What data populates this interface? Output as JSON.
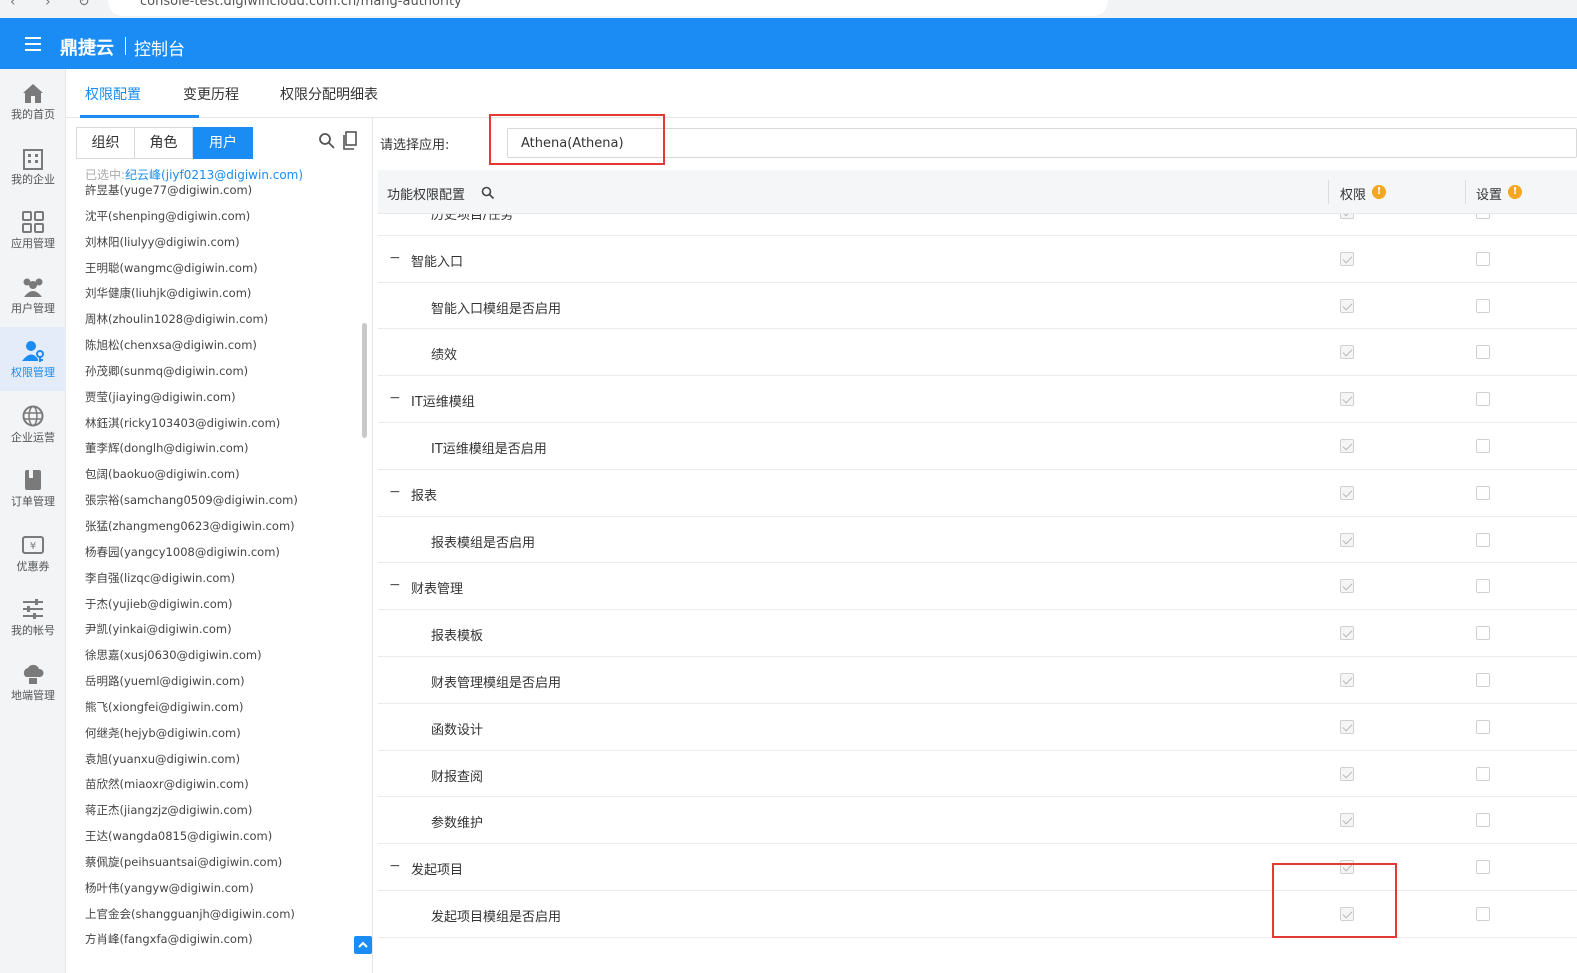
{
  "browser": {
    "url": "console-test.digiwincloud.com.cn/mang-authority"
  },
  "header": {
    "brand": "鼎捷云",
    "console": "控制台"
  },
  "leftnav": {
    "items": [
      {
        "label": "我的首页",
        "icon": "home-icon"
      },
      {
        "label": "我的企业",
        "icon": "building-icon"
      },
      {
        "label": "应用管理",
        "icon": "apps-icon"
      },
      {
        "label": "用户管理",
        "icon": "users-icon"
      },
      {
        "label": "权限管理",
        "icon": "user-key-icon",
        "active": true
      },
      {
        "label": "企业运营",
        "icon": "globe-icon"
      },
      {
        "label": "订单管理",
        "icon": "order-book-icon"
      },
      {
        "label": "优惠券",
        "icon": "coupon-icon"
      },
      {
        "label": "我的帐号",
        "icon": "sliders-icon"
      },
      {
        "label": "地端管理",
        "icon": "cloud-server-icon"
      }
    ]
  },
  "tabs": [
    {
      "label": "权限配置",
      "active": true
    },
    {
      "label": "变更历程"
    },
    {
      "label": "权限分配明细表"
    }
  ],
  "userpanel": {
    "segments": [
      {
        "label": "组织"
      },
      {
        "label": "角色"
      },
      {
        "label": "用户",
        "active": true
      }
    ],
    "selected_prefix": "已选中:",
    "selected_user": "纪云峰(jiyf0213@digiwin.com)",
    "users": [
      "許昱基(yuge77@digiwin.com)",
      "沈平(shenping@digiwin.com)",
      "刘林阳(liulyy@digiwin.com)",
      "王明聪(wangmc@digiwin.com)",
      "刘华健康(liuhjk@digiwin.com)",
      "周林(zhoulin1028@digiwin.com)",
      "陈旭松(chenxsa@digiwin.com)",
      "孙茂卿(sunmq@digiwin.com)",
      "贾莹(jiaying@digiwin.com)",
      "林鈺淇(ricky103403@digiwin.com)",
      "董李辉(donglh@digiwin.com)",
      "包阔(baokuo@digiwin.com)",
      "張宗裕(samchang0509@digiwin.com)",
      "张猛(zhangmeng0623@digiwin.com)",
      "杨春园(yangcy1008@digiwin.com)",
      "李自强(lizqc@digiwin.com)",
      "于杰(yujieb@digiwin.com)",
      "尹凯(yinkai@digiwin.com)",
      "徐思嘉(xusj0630@digiwin.com)",
      "岳明路(yueml@digiwin.com)",
      "熊飞(xiongfei@digiwin.com)",
      "何继尧(hejyb@digiwin.com)",
      "袁旭(yuanxu@digiwin.com)",
      "苗欣然(miaoxr@digiwin.com)",
      "蒋正杰(jiangzjz@digiwin.com)",
      "王达(wangda0815@digiwin.com)",
      "蔡佩旋(peihsuantsai@digiwin.com)",
      "杨叶伟(yangyw@digiwin.com)",
      "上官金会(shangguanjh@digiwin.com)",
      "方肖峰(fangxfa@digiwin.com)"
    ]
  },
  "main": {
    "app_label": "请选择应用:",
    "app_value": "Athena(Athena)",
    "columns": {
      "feature": "功能权限配置",
      "permission": "权限",
      "setting": "设置"
    },
    "rows": [
      {
        "name": "历史项目/任务",
        "level": 1
      },
      {
        "name": "智能入口",
        "level": 0
      },
      {
        "name": "智能入口模组是否启用",
        "level": 1
      },
      {
        "name": "绩效",
        "level": 1
      },
      {
        "name": "IT运维模组",
        "level": 0
      },
      {
        "name": "IT运维模组是否启用",
        "level": 1
      },
      {
        "name": "报表",
        "level": 0
      },
      {
        "name": "报表模组是否启用",
        "level": 1
      },
      {
        "name": "财表管理",
        "level": 0
      },
      {
        "name": "报表模板",
        "level": 1
      },
      {
        "name": "财表管理模组是否启用",
        "level": 1
      },
      {
        "name": "函数设计",
        "level": 1
      },
      {
        "name": "财报查阅",
        "level": 1
      },
      {
        "name": "参数维护",
        "level": 1
      },
      {
        "name": "发起项目",
        "level": 0
      },
      {
        "name": "发起项目模组是否启用",
        "level": 1
      }
    ]
  }
}
